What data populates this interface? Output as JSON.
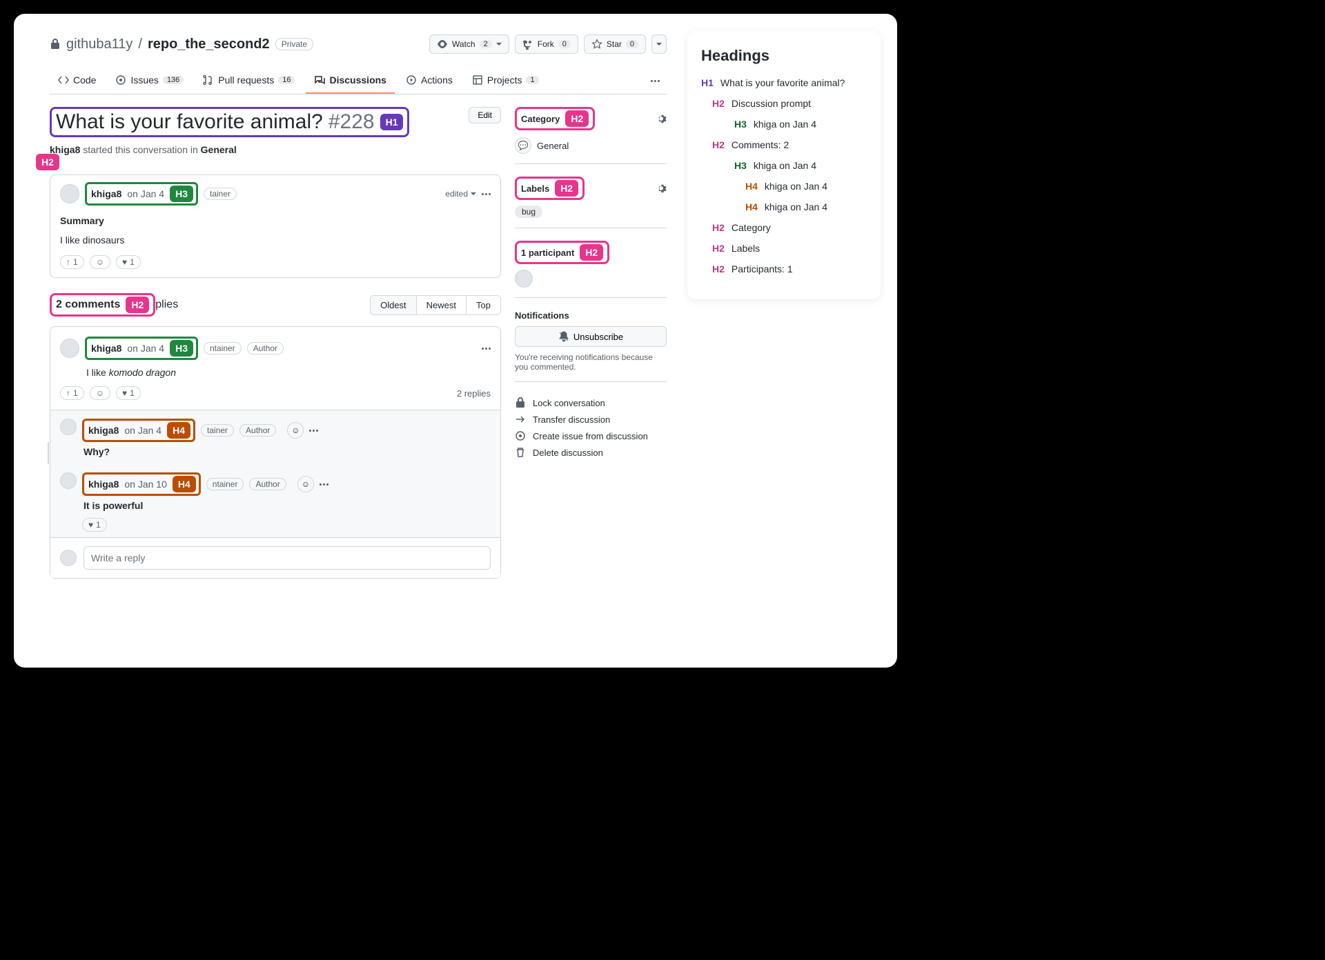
{
  "repo": {
    "owner": "githuba11y",
    "name": "repo_the_second2",
    "privacy": "Private"
  },
  "actions": {
    "watch": {
      "label": "Watch",
      "count": "2"
    },
    "fork": {
      "label": "Fork",
      "count": "0"
    },
    "star": {
      "label": "Star",
      "count": "0"
    }
  },
  "tabs": {
    "code": "Code",
    "issues": {
      "label": "Issues",
      "count": "136"
    },
    "pulls": {
      "label": "Pull requests",
      "count": "16"
    },
    "discussions": "Discussions",
    "actions": "Actions",
    "projects": {
      "label": "Projects",
      "count": "1"
    }
  },
  "title": {
    "text": "What is your favorite animal?",
    "number": "#228",
    "badge": "H1",
    "edit": "Edit"
  },
  "subline": {
    "user": "khiga8",
    "middle": " started this conversation in ",
    "category": "General"
  },
  "h2_badge": "H2",
  "op": {
    "user": "khiga8",
    "date": "on Jan 4",
    "badge": "H3",
    "role": "tainer",
    "edited": "edited",
    "summary": "Summary",
    "body": "I like dinosaurs",
    "upvote": "1",
    "heart": "1"
  },
  "comments_header": {
    "text": "2 comments",
    "badge": "H2",
    "suffix": "plies"
  },
  "sort": {
    "oldest": "Oldest",
    "newest": "Newest",
    "top": "Top"
  },
  "comment": {
    "user": "khiga8",
    "date": "on Jan 4",
    "badge": "H3",
    "role1": "ntainer",
    "role2": "Author",
    "body_pre": "I like ",
    "body_em": "komodo dragon",
    "upvote": "1",
    "heart": "1",
    "replies": "2 replies"
  },
  "reply1": {
    "user": "khiga8",
    "date": "on Jan 4",
    "badge": "H4",
    "role1": "tainer",
    "role2": "Author",
    "body": "Why?"
  },
  "reply2": {
    "user": "khiga8",
    "date": "on Jan 10",
    "badge": "H4",
    "role1": "ntainer",
    "role2": "Author",
    "body": "It is powerful",
    "heart": "1"
  },
  "write_placeholder": "Write a reply",
  "sidebar": {
    "category": {
      "label": "Category",
      "badge": "H2",
      "value": "General",
      "icon": "💬"
    },
    "labels": {
      "label": "Labels",
      "badge": "H2",
      "items": [
        "bug"
      ]
    },
    "participants": {
      "label": "1 participant",
      "badge": "H2"
    },
    "notifications": {
      "title": "Notifications",
      "unsubscribe": "Unsubscribe",
      "desc": "You're receiving notifications because you commented."
    },
    "actions": {
      "lock": "Lock conversation",
      "transfer": "Transfer discussion",
      "create_issue": "Create issue from discussion",
      "delete": "Delete discussion"
    }
  },
  "headings_panel": {
    "title": "Headings",
    "items": [
      {
        "level": "h1",
        "tag": "H1",
        "text": "What is your favorite animal?"
      },
      {
        "level": "h2",
        "tag": "H2",
        "text": "Discussion prompt"
      },
      {
        "level": "h3",
        "tag": "H3",
        "text": "khiga on Jan 4"
      },
      {
        "level": "h2",
        "tag": "H2",
        "text": "Comments: 2"
      },
      {
        "level": "h3",
        "tag": "H3",
        "text": "khiga on Jan 4"
      },
      {
        "level": "h4",
        "tag": "H4",
        "text": "khiga on Jan 4"
      },
      {
        "level": "h4",
        "tag": "H4",
        "text": "khiga on Jan 4"
      },
      {
        "level": "h2",
        "tag": "H2",
        "text": "Category"
      },
      {
        "level": "h2",
        "tag": "H2",
        "text": "Labels"
      },
      {
        "level": "h2",
        "tag": "H2",
        "text": "Participants: 1"
      }
    ]
  }
}
